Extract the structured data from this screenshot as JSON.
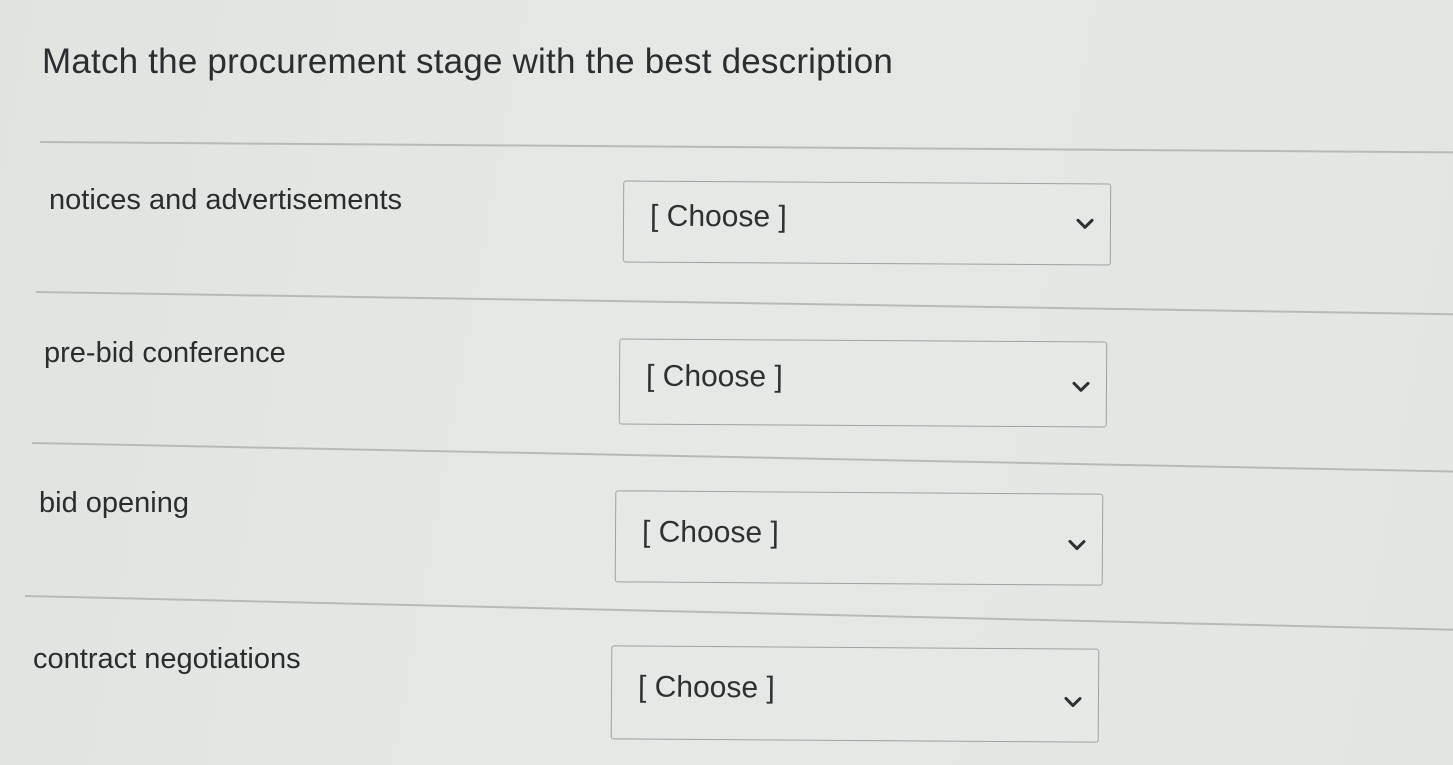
{
  "question": {
    "title": "Match the procurement stage with the best description"
  },
  "matches": [
    {
      "label": "notices and advertisements",
      "selected": "[ Choose ]",
      "icon": "chevron-down-icon"
    },
    {
      "label": "pre-bid conference",
      "selected": "[ Choose ]",
      "icon": "chevron-down-icon"
    },
    {
      "label": "bid opening",
      "selected": "[ Choose ]",
      "icon": "chevron-down-icon"
    },
    {
      "label": "contract negotiations",
      "selected": "[ Choose ]",
      "icon": "chevron-down-icon"
    }
  ]
}
